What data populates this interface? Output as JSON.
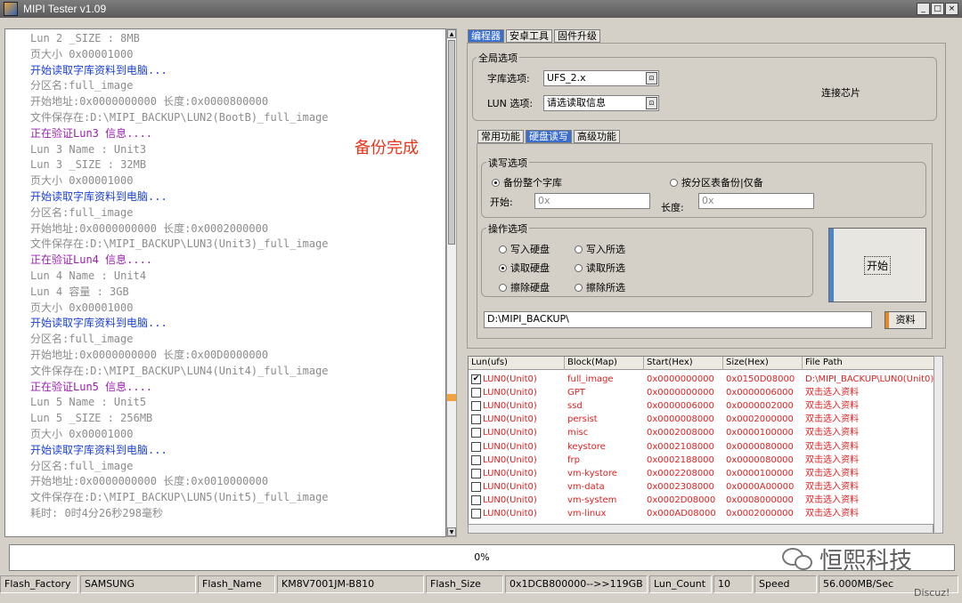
{
  "window": {
    "title": "MIPI Tester v1.09",
    "btn_min": "_",
    "btn_max": "□",
    "btn_close": "×"
  },
  "log": {
    "lines": [
      {
        "text": "Lun 2 _SIZE : 8MB",
        "c": "gray"
      },
      {
        "text": "页大小 0x00001000",
        "c": "gray"
      },
      {
        "text": "开始读取字库资料到电脑...",
        "c": "blue"
      },
      {
        "text": "分区名:full_image",
        "c": "gray"
      },
      {
        "text": "开始地址:0x0000000000   长度:0x0000800000",
        "c": "gray"
      },
      {
        "text": "文件保存在:D:\\MIPI_BACKUP\\LUN2(BootB)_full_image",
        "c": "gray"
      },
      {
        "text": "正在验证Lun3 信息....",
        "c": "purple"
      },
      {
        "text": "Lun 3 Name : Unit3",
        "c": "gray"
      },
      {
        "text": "Lun 3 _SIZE : 32MB",
        "c": "gray"
      },
      {
        "text": "页大小 0x00001000",
        "c": "gray"
      },
      {
        "text": "开始读取字库资料到电脑...",
        "c": "blue"
      },
      {
        "text": "分区名:full_image",
        "c": "gray"
      },
      {
        "text": "开始地址:0x0000000000   长度:0x0002000000",
        "c": "gray"
      },
      {
        "text": "文件保存在:D:\\MIPI_BACKUP\\LUN3(Unit3)_full_image",
        "c": "gray"
      },
      {
        "text": "正在验证Lun4 信息....",
        "c": "purple"
      },
      {
        "text": "Lun 4 Name : Unit4",
        "c": "gray"
      },
      {
        "text": "Lun 4 容量 : 3GB",
        "c": "gray"
      },
      {
        "text": "页大小 0x00001000",
        "c": "gray"
      },
      {
        "text": "开始读取字库资料到电脑...",
        "c": "blue"
      },
      {
        "text": "分区名:full_image",
        "c": "gray"
      },
      {
        "text": "开始地址:0x0000000000   长度:0x00D0000000",
        "c": "gray"
      },
      {
        "text": "文件保存在:D:\\MIPI_BACKUP\\LUN4(Unit4)_full_image",
        "c": "gray"
      },
      {
        "text": "正在验证Lun5 信息....",
        "c": "purple"
      },
      {
        "text": "Lun 5 Name : Unit5",
        "c": "gray"
      },
      {
        "text": "Lun 5 _SIZE : 256MB",
        "c": "gray"
      },
      {
        "text": "页大小 0x00001000",
        "c": "gray"
      },
      {
        "text": "开始读取字库资料到电脑...",
        "c": "blue"
      },
      {
        "text": "分区名:full_image",
        "c": "gray"
      },
      {
        "text": "开始地址:0x0000000000   长度:0x0010000000",
        "c": "gray"
      },
      {
        "text": "文件保存在:D:\\MIPI_BACKUP\\LUN5(Unit5)_full_image",
        "c": "gray"
      },
      {
        "text": "耗时: 0时4分26秒298毫秒",
        "c": "gray"
      }
    ],
    "done_label": "备份完成"
  },
  "top_tabs": [
    "编程器",
    "安卓工具",
    "固件升级"
  ],
  "global": {
    "legend": "全局选项",
    "lib_label": "字库选项:",
    "lib_value": "UFS_2.x",
    "lun_label": "LUN 选项:",
    "lun_value": "请选读取信息",
    "connect_label": "连接芯片"
  },
  "sub_tabs": [
    "常用功能",
    "硬盘读写",
    "高级功能"
  ],
  "rw": {
    "legend": "读写选项",
    "opt_full": "备份整个字库",
    "opt_part": "按分区表备份|仅备",
    "start_label": "开始:",
    "start_placeholder": "0x",
    "len_label": "长度:",
    "len_placeholder": "0x"
  },
  "ops": {
    "legend": "操作选项",
    "write_disk": "写入硬盘",
    "write_sel": "写入所选",
    "read_disk": "读取硬盘",
    "read_sel": "读取所选",
    "erase_disk": "擦除硬盘",
    "erase_sel": "擦除所选",
    "start_btn": "开始"
  },
  "path": {
    "value": "D:\\MIPI_BACKUP\\",
    "browse": "资料"
  },
  "table": {
    "headers": [
      "Lun(ufs)",
      "Block(Map)",
      "Start(Hex)",
      "Size(Hex)",
      "File Path"
    ],
    "rows": [
      {
        "checked": true,
        "lun": "LUN0(Unit0)",
        "block": "full_image",
        "start": "0x0000000000",
        "size": "0x0150D08000",
        "path": "D:\\MIPI_BACKUP\\LUN0(Unit0)_full"
      },
      {
        "checked": false,
        "lun": "LUN0(Unit0)",
        "block": "GPT",
        "start": "0x0000000000",
        "size": "0x0000006000",
        "path": "双击选入资料"
      },
      {
        "checked": false,
        "lun": "LUN0(Unit0)",
        "block": "ssd",
        "start": "0x0000006000",
        "size": "0x0000002000",
        "path": "双击选入资料"
      },
      {
        "checked": false,
        "lun": "LUN0(Unit0)",
        "block": "persist",
        "start": "0x0000008000",
        "size": "0x0002000000",
        "path": "双击选入资料"
      },
      {
        "checked": false,
        "lun": "LUN0(Unit0)",
        "block": "misc",
        "start": "0x0002008000",
        "size": "0x0000100000",
        "path": "双击选入资料"
      },
      {
        "checked": false,
        "lun": "LUN0(Unit0)",
        "block": "keystore",
        "start": "0x0002108000",
        "size": "0x0000080000",
        "path": "双击选入资料"
      },
      {
        "checked": false,
        "lun": "LUN0(Unit0)",
        "block": "frp",
        "start": "0x0002188000",
        "size": "0x0000080000",
        "path": "双击选入资料"
      },
      {
        "checked": false,
        "lun": "LUN0(Unit0)",
        "block": "vm-kystore",
        "start": "0x0002208000",
        "size": "0x0000100000",
        "path": "双击选入资料"
      },
      {
        "checked": false,
        "lun": "LUN0(Unit0)",
        "block": "vm-data",
        "start": "0x0002308000",
        "size": "0x0000A00000",
        "path": "双击选入资料"
      },
      {
        "checked": false,
        "lun": "LUN0(Unit0)",
        "block": "vm-system",
        "start": "0x0002D08000",
        "size": "0x0008000000",
        "path": "双击选入资料"
      },
      {
        "checked": false,
        "lun": "LUN0(Unit0)",
        "block": "vm-linux",
        "start": "0x000AD08000",
        "size": "0x0002000000",
        "path": "双击选入资料"
      }
    ]
  },
  "progress": {
    "text": "0%"
  },
  "status": {
    "flash_factory_label": "Flash_Factory",
    "flash_factory": "SAMSUNG",
    "flash_name_label": "Flash_Name",
    "flash_name": "KM8V7001JM-B810",
    "flash_size_label": "Flash_Size",
    "flash_size": "0x1DCB800000-->>119GB",
    "lun_count_label": "Lun_Count",
    "lun_count": "10",
    "speed_label": "Speed",
    "speed": "56.000MB/Sec"
  },
  "watermark": {
    "text": "恒熙科技",
    "discuz": "Discuz!"
  }
}
